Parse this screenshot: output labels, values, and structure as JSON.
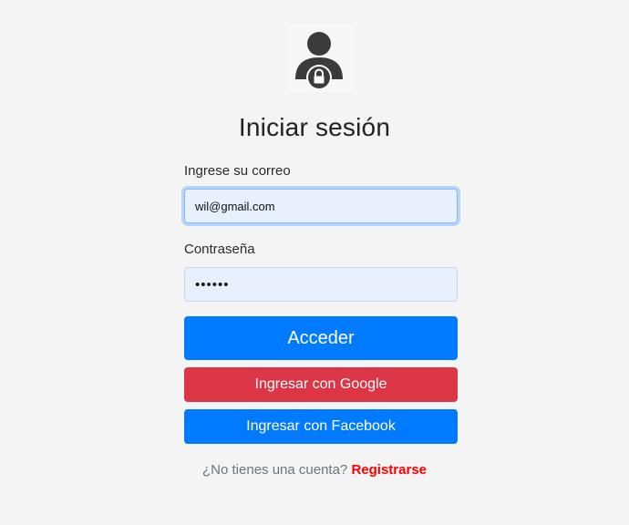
{
  "logo": {
    "icon": "user-lock-icon"
  },
  "title": "Iniciar sesión",
  "form": {
    "email": {
      "label": "Ingrese su correo",
      "value": "wil@gmail.com"
    },
    "password": {
      "label": "Contraseña",
      "value": "••••••"
    },
    "submit_label": "Acceder",
    "google_label": "Ingresar con Google",
    "facebook_label": "Ingresar con Facebook"
  },
  "footer": {
    "prompt": "¿No tienes una cuenta?",
    "register_link": "Registrarse"
  },
  "colors": {
    "primary": "#007bff",
    "google": "#dc3545",
    "register_link": "#ff0000"
  }
}
